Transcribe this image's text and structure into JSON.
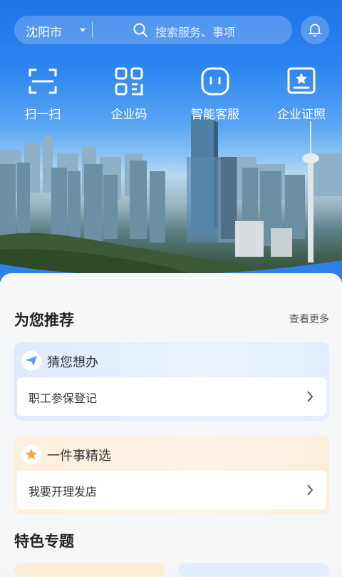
{
  "location": {
    "city": "沈阳市"
  },
  "search": {
    "placeholder": "搜索服务、事项"
  },
  "quick_actions": [
    {
      "label": "扫一扫",
      "icon": "scan-icon"
    },
    {
      "label": "企业码",
      "icon": "qr-code-icon"
    },
    {
      "label": "智能客服",
      "icon": "robot-service-icon"
    },
    {
      "label": "企业证照",
      "icon": "license-certificate-icon"
    }
  ],
  "recommend": {
    "title": "为您推荐",
    "more": "查看更多",
    "guess": {
      "title": "猜您想办",
      "icon": "paper-plane-icon",
      "item": "职工参保登记"
    },
    "featured": {
      "title": "一件事精选",
      "icon": "star-icon",
      "item": "我要开理发店"
    }
  },
  "features": {
    "title": "特色专题"
  },
  "colors": {
    "brand": "#1f73e6",
    "accent_orange": "#f0a84a"
  }
}
